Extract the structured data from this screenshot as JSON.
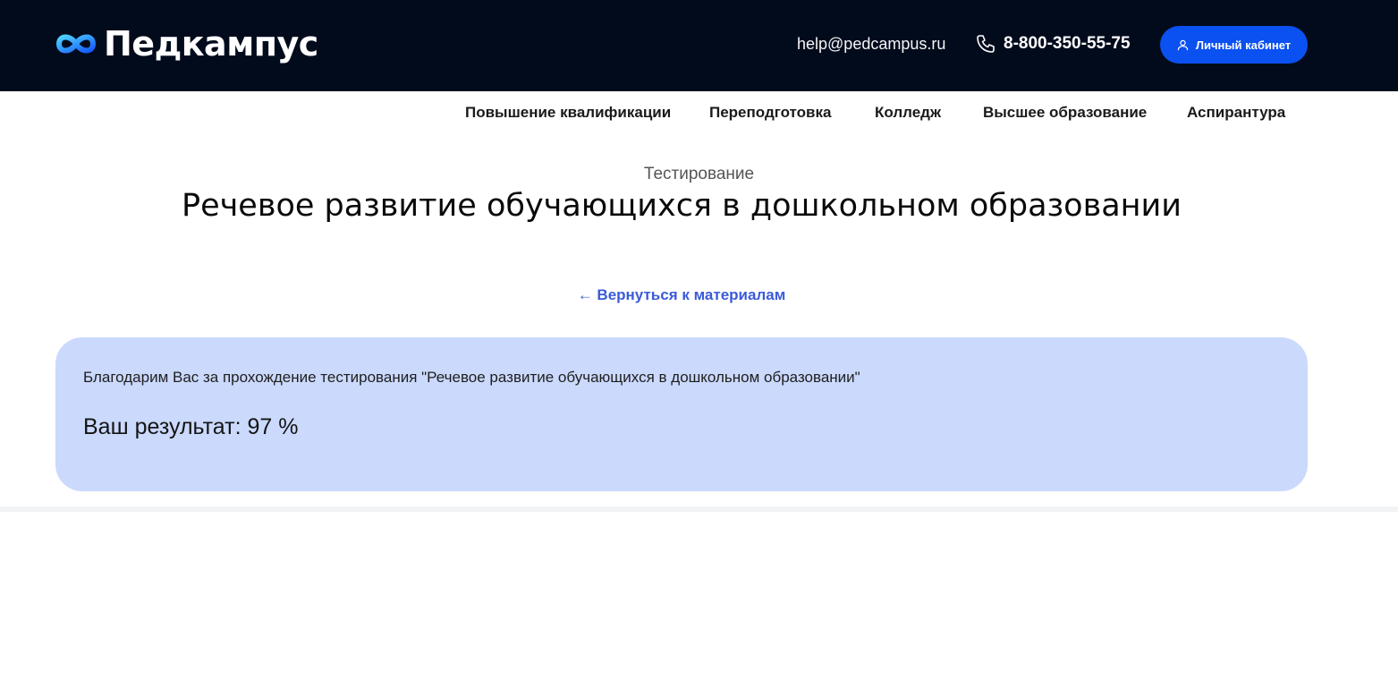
{
  "header": {
    "logo_text": "Педкампус",
    "email": "help@pedcampus.ru",
    "phone": "8-800-350-55-75",
    "cabinet_button": "Личный кабинет"
  },
  "nav": {
    "items": [
      {
        "label": "Повышение квалификации"
      },
      {
        "label": "Переподготовка"
      },
      {
        "label": "Колледж"
      },
      {
        "label": "Высшее образование"
      },
      {
        "label": "Аспирантура"
      }
    ]
  },
  "page": {
    "subtitle": "Тестирование",
    "title": "Речевое развитие обучающихся в дошкольном образовании",
    "back_link": "← Вернуться к материалам"
  },
  "result": {
    "thanks_text": "Благодарим Вас за прохождение тестирования \"Речевое развитие обучающихся в дошкольном образовании\"",
    "score_text": "Ваш результат: 97 %"
  },
  "icons": {
    "logo": "infinity-logo-icon",
    "phone": "phone-icon",
    "user": "user-icon"
  },
  "colors": {
    "header_bg": "#020b1c",
    "accent_button": "#0b50f0",
    "link": "#3b5bd9",
    "result_card_bg": "#cad9fc"
  }
}
